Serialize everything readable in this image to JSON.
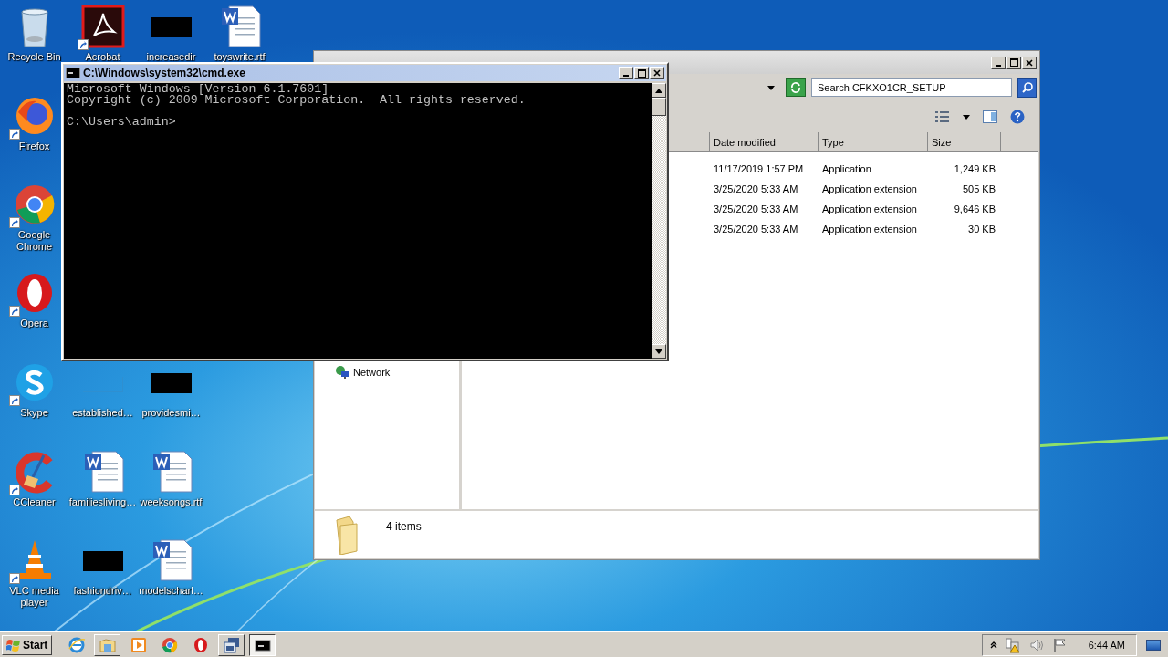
{
  "desktop_icons": [
    {
      "label": "Recycle Bin",
      "kind": "recycle",
      "shortcut": false
    },
    {
      "label": "Acrobat",
      "kind": "acrobat",
      "shortcut": true
    },
    {
      "label": "increasedir",
      "kind": "dark",
      "shortcut": false
    },
    {
      "label": "toyswrite.rtf",
      "kind": "word",
      "shortcut": false
    },
    {
      "label": "Firefox",
      "kind": "firefox",
      "shortcut": true
    },
    {
      "label": "Google Chrome",
      "kind": "chrome",
      "shortcut": true
    },
    {
      "label": "Opera",
      "kind": "opera",
      "shortcut": true
    },
    {
      "label": "Skype",
      "kind": "skype",
      "shortcut": true
    },
    {
      "label": "established…",
      "kind": "faint",
      "shortcut": false
    },
    {
      "label": "providesmi…",
      "kind": "dark",
      "shortcut": false
    },
    {
      "label": "CCleaner",
      "kind": "ccleaner",
      "shortcut": true
    },
    {
      "label": "familiesliving…",
      "kind": "word",
      "shortcut": false
    },
    {
      "label": "weeksongs.rtf",
      "kind": "word",
      "shortcut": false
    },
    {
      "label": "VLC media player",
      "kind": "vlc",
      "shortcut": true
    },
    {
      "label": "fashiondriv…",
      "kind": "dark",
      "shortcut": false
    },
    {
      "label": "modelscharl…",
      "kind": "word",
      "shortcut": false
    }
  ],
  "explorer": {
    "search": {
      "placeholder": "Search CFKXO1CR_SETUP"
    },
    "columns": [
      "Date modified",
      "Type",
      "Size"
    ],
    "rows": [
      {
        "date": "11/17/2019 1:57 PM",
        "type": "Application",
        "size": "1,249 KB"
      },
      {
        "date": "3/25/2020 5:33 AM",
        "type": "Application extension",
        "size": "505 KB"
      },
      {
        "date": "3/25/2020 5:33 AM",
        "type": "Application extension",
        "size": "9,646 KB"
      },
      {
        "date": "3/25/2020 5:33 AM",
        "type": "Application extension",
        "size": "30 KB"
      }
    ],
    "nav_items": [
      {
        "label": "Network"
      }
    ],
    "status": "4 items"
  },
  "cmd": {
    "title": "C:\\Windows\\system32\\cmd.exe",
    "lines": [
      "Microsoft Windows [Version 6.1.7601]",
      "Copyright (c) 2009 Microsoft Corporation.  All rights reserved."
    ],
    "prompt": "C:\\Users\\admin>"
  },
  "taskbar": {
    "start": "Start",
    "items": [
      {
        "kind": "ie",
        "running": false,
        "selected": false
      },
      {
        "kind": "explorer",
        "running": true,
        "selected": false
      },
      {
        "kind": "media",
        "running": false,
        "selected": false
      },
      {
        "kind": "chrome",
        "running": false,
        "selected": false
      },
      {
        "kind": "opera",
        "running": false,
        "selected": false
      },
      {
        "kind": "app",
        "running": true,
        "selected": false
      },
      {
        "kind": "cmd",
        "running": true,
        "selected": true
      }
    ],
    "clock": "6:44 AM"
  }
}
